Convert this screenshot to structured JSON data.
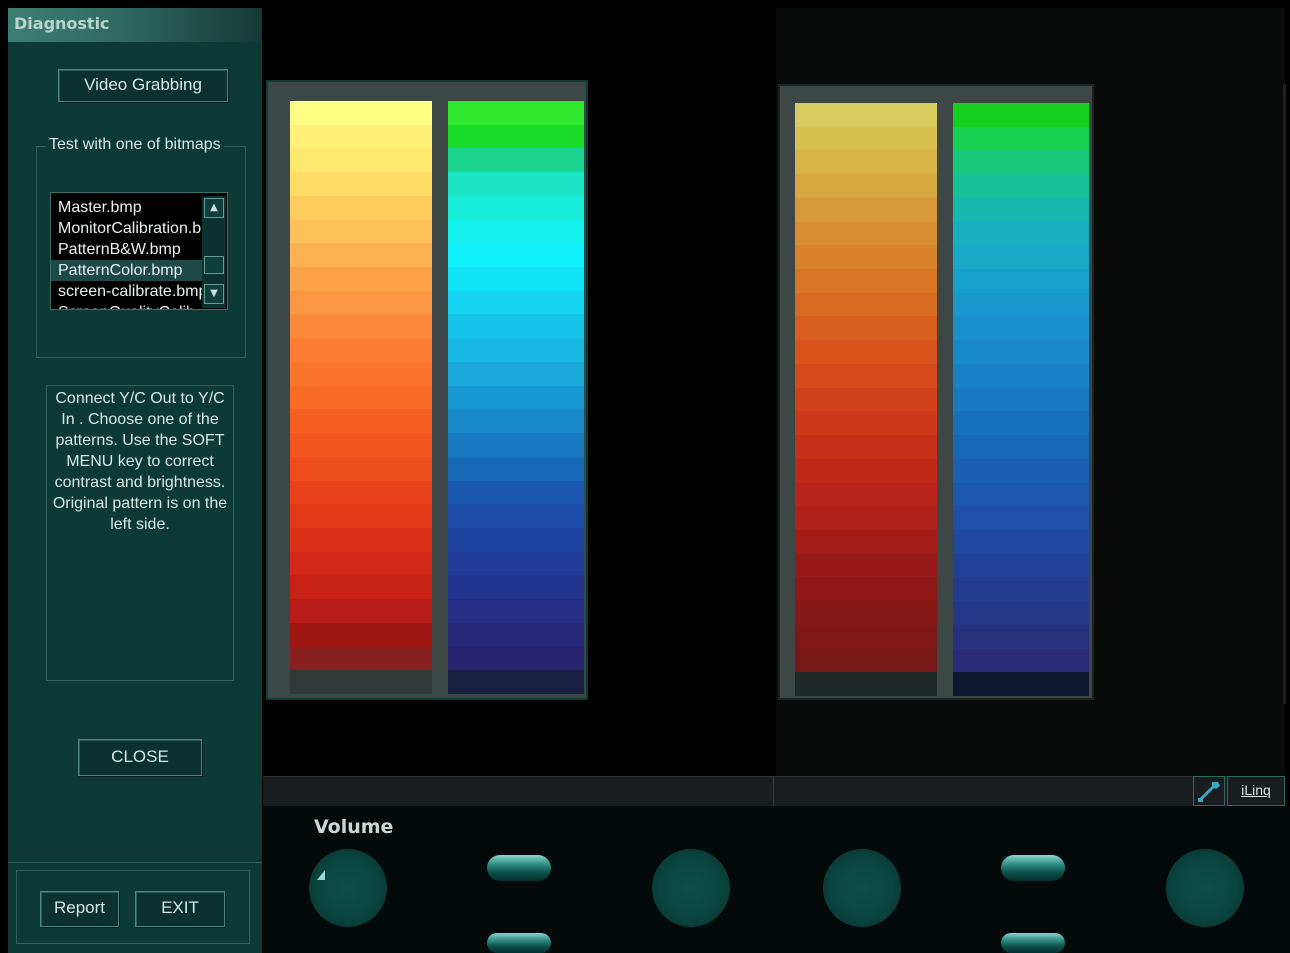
{
  "window": {
    "title": "Diagnostic"
  },
  "panel": {
    "video_grabbing_label": "Video Grabbing",
    "group_label": "Test with one of bitmaps",
    "bitmaps": [
      {
        "name": "Master.bmp",
        "selected": false
      },
      {
        "name": "MonitorCalibration.b",
        "selected": false
      },
      {
        "name": "PatternB&W.bmp",
        "selected": false
      },
      {
        "name": "PatternColor.bmp",
        "selected": true
      },
      {
        "name": "screen-calibrate.bmp",
        "selected": false
      },
      {
        "name": "ScreenQualityCalib",
        "selected": false
      }
    ],
    "scroll_up_icon": "scroll-up-arrow",
    "scroll_down_icon": "scroll-down-arrow",
    "instructions": "Connect Y/C Out to Y/C In . Choose one of the patterns. Use the SOFT MENU key to correct contrast and brightness. Original pattern is on the left side.",
    "close_label": "CLOSE",
    "report_label": "Report",
    "exit_label": "EXIT"
  },
  "patterns": {
    "left_original": {
      "warm": [
        "#fefe84",
        "#fdf17a",
        "#fde870",
        "#fddd66",
        "#fdcd60",
        "#fdc05a",
        "#fcb152",
        "#fca34a",
        "#fb9644",
        "#fb8a3c",
        "#fb7e34",
        "#fa742c",
        "#f86a26",
        "#f56022",
        "#f2561e",
        "#ee4c1c",
        "#e9421a",
        "#e33818",
        "#dc3018",
        "#d42818",
        "#c82218",
        "#b81c18",
        "#a01816",
        "#882020",
        "#303838"
      ],
      "cool": [
        "#30e830",
        "#18dc28",
        "#1ad490",
        "#1ae4c4",
        "#18ecd8",
        "#14f0ec",
        "#10f0fa",
        "#12e4f8",
        "#14d4f2",
        "#16c4ea",
        "#18b8e4",
        "#1aa8d8",
        "#1898d0",
        "#1888c8",
        "#1878c0",
        "#1868b8",
        "#1a58b0",
        "#1c4ca8",
        "#1e42a0",
        "#203a98",
        "#22348e",
        "#242e84",
        "#26287a",
        "#282470",
        "#1a1e40"
      ]
    },
    "right_captured": {
      "warm": [
        "#d8cc60",
        "#d8c050",
        "#d8b448",
        "#d8a840",
        "#d89a38",
        "#d88e30",
        "#d8822a",
        "#d87626",
        "#d86a22",
        "#d85e1e",
        "#d8541c",
        "#d44a1a",
        "#d04018",
        "#cc3818",
        "#c63018",
        "#c02818",
        "#b82418",
        "#ae2018",
        "#a41c18",
        "#981a18",
        "#8e1818",
        "#861818",
        "#7e1818",
        "#761818",
        "#202828"
      ],
      "cool": [
        "#18d020",
        "#18d050",
        "#18c878",
        "#18c098",
        "#18b8b0",
        "#18b0c0",
        "#18a8c8",
        "#18a0cc",
        "#1898cc",
        "#1890cc",
        "#1888c8",
        "#1880c4",
        "#1878c0",
        "#1870bc",
        "#1868b8",
        "#1a60b4",
        "#1c58ae",
        "#1e50a8",
        "#2048a0",
        "#224298",
        "#243c90",
        "#263688",
        "#283080",
        "#2a2a78",
        "#101830"
      ]
    }
  },
  "status": {
    "wrench_icon": "wrench-icon",
    "iling_label": "iLinq"
  },
  "softkeys": {
    "volume_label": "Volume"
  }
}
